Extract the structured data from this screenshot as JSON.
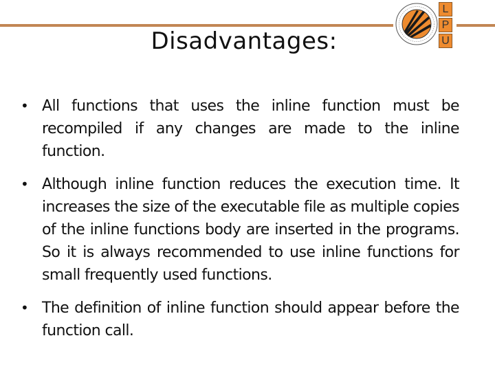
{
  "header": {
    "title": "Disadvantages:",
    "logo": {
      "seal_icon": "university-seal-icon",
      "letters": [
        "L",
        "P",
        "U"
      ],
      "accent_color": "#ee8b2f",
      "rule_color": "#c28654"
    }
  },
  "bullets": [
    {
      "text": "All functions that uses the inline function must be recompiled if any changes are made to the inline function."
    },
    {
      "text": "Although inline function reduces the execution time. It increases the size of the executable file as multiple copies of the inline functions body are inserted in the programs. So it is always recommended to use inline functions for small frequently used functions."
    },
    {
      "text": "The definition of inline function should appear before the function call."
    }
  ],
  "bullet_glyph": "•"
}
